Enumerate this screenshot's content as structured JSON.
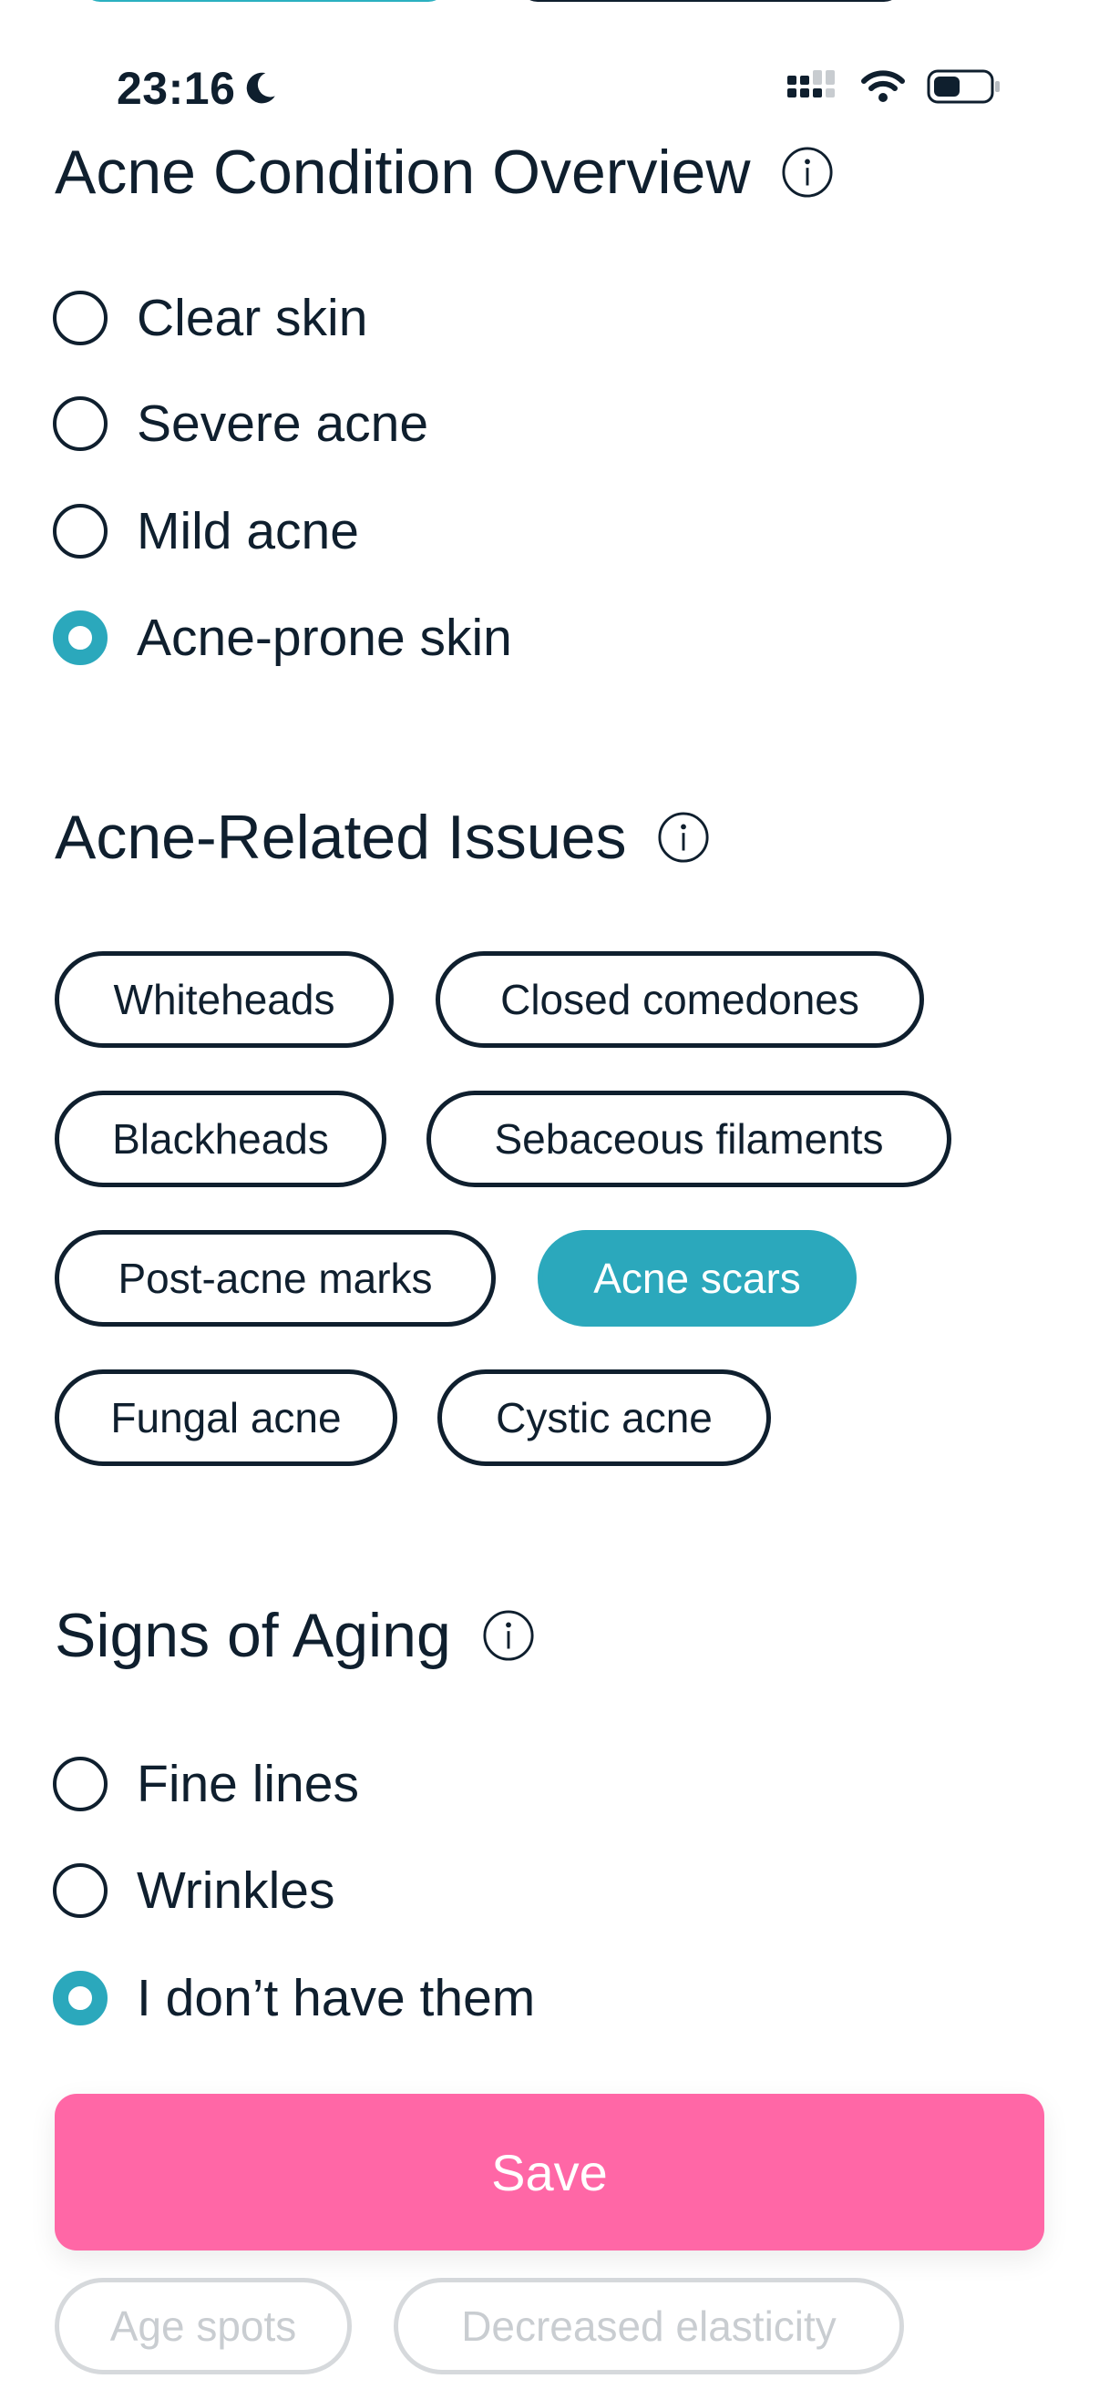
{
  "status_bar": {
    "time": "23:16",
    "icons": [
      "moon-icon",
      "signal-icon",
      "wifi-icon",
      "battery-icon"
    ]
  },
  "acne_condition": {
    "title": "Acne Condition Overview",
    "options": [
      {
        "label": "Clear skin",
        "selected": false
      },
      {
        "label": "Severe acne",
        "selected": false
      },
      {
        "label": "Mild acne",
        "selected": false
      },
      {
        "label": "Acne-prone skin",
        "selected": true
      }
    ]
  },
  "acne_issues": {
    "title": "Acne-Related Issues",
    "chips": [
      {
        "label": "Whiteheads",
        "selected": false
      },
      {
        "label": "Closed comedones",
        "selected": false
      },
      {
        "label": "Blackheads",
        "selected": false
      },
      {
        "label": "Sebaceous filaments",
        "selected": false
      },
      {
        "label": "Post-acne marks",
        "selected": false
      },
      {
        "label": "Acne scars",
        "selected": true
      },
      {
        "label": "Fungal acne",
        "selected": false
      },
      {
        "label": "Cystic acne",
        "selected": false
      }
    ]
  },
  "aging": {
    "title": "Signs of Aging",
    "options": [
      {
        "label": "Fine lines",
        "selected": false
      },
      {
        "label": "Wrinkles",
        "selected": false
      },
      {
        "label": "I don’t have them",
        "selected": true
      }
    ]
  },
  "hidden_chips": {
    "chips": [
      {
        "label": "Age spots"
      },
      {
        "label": "Decreased elasticity"
      }
    ]
  },
  "save": {
    "label": "Save"
  },
  "colors": {
    "accent": "#2ba8bc",
    "save_button": "#ff67a6",
    "text": "#0f1f2e"
  }
}
